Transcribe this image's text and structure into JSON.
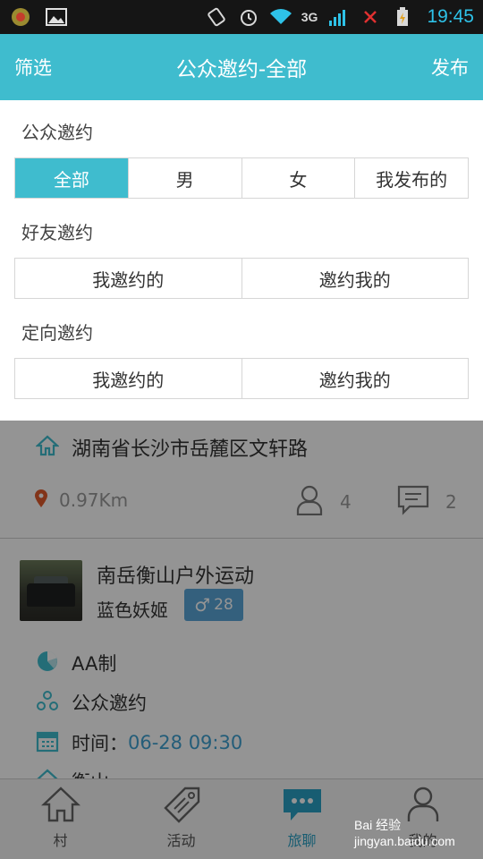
{
  "status_bar": {
    "time": "19:45",
    "network": "3G"
  },
  "header": {
    "left_label": "筛选",
    "title": "公众邀约-全部",
    "right_label": "发布"
  },
  "filter": {
    "public": {
      "label": "公众邀约",
      "options": [
        "全部",
        "男",
        "女",
        "我发布的"
      ],
      "selected": "全部"
    },
    "friend": {
      "label": "好友邀约",
      "options": [
        "我邀约的",
        "邀约我的"
      ]
    },
    "directed": {
      "label": "定向邀约",
      "options": [
        "我邀约的",
        "邀约我的"
      ]
    }
  },
  "card1": {
    "address": "湖南省长沙市岳麓区文轩路",
    "distance": "0.97Km",
    "people_count": "4",
    "comment_count": "2"
  },
  "card2": {
    "title": "南岳衡山户外运动",
    "nickname": "蓝色妖姬",
    "gender_symbol": "♂",
    "age": "28",
    "payment": "AA制",
    "invite_type": "公众邀约",
    "time_label": "时间：",
    "time_value": "06-28 09:30",
    "partial_text": "衡山"
  },
  "bottom_nav": {
    "items": [
      {
        "label": "村",
        "icon": "house-icon"
      },
      {
        "label": "活动",
        "icon": "tag-icon"
      },
      {
        "label": "旅聊",
        "icon": "chat-icon"
      },
      {
        "label": "我的",
        "icon": "person-icon"
      }
    ],
    "active": "旅聊"
  },
  "watermark": "Bai 经验 jingyan.baidu.com",
  "colors": {
    "accent": "#3fbcce",
    "active_nav": "#2aa0c4",
    "badge": "#5aa5d8",
    "location_pin": "#e05a2b"
  }
}
